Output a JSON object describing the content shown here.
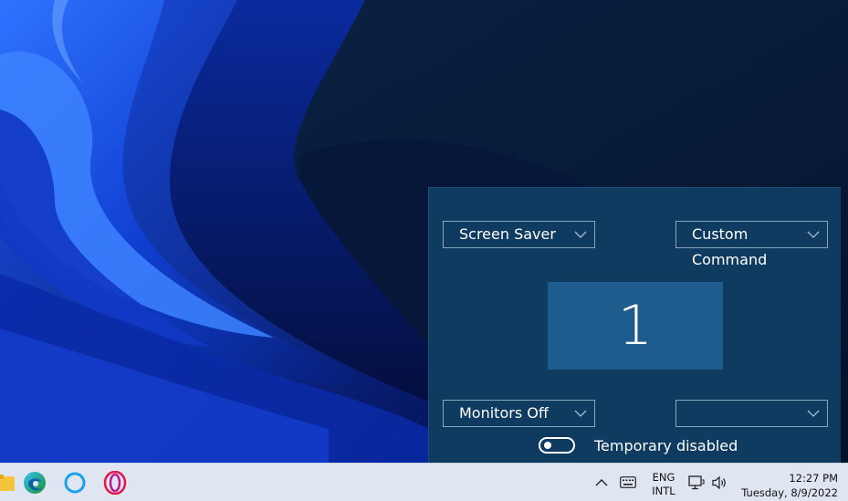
{
  "panel": {
    "top_left_action": "Screen Saver",
    "top_right_action": "Custom Command",
    "bottom_left_action": "Monitors Off",
    "bottom_right_action": "",
    "monitor_number": "1",
    "toggle_label": "Temporary disabled",
    "toggle_on": false
  },
  "taskbar": {
    "pinned_icons": [
      "file-explorer-icon",
      "edge-icon",
      "cortana-icon",
      "opera-icon"
    ],
    "tray": {
      "language_line1": "ENG",
      "language_line2": "INTL",
      "time": "12:27 PM",
      "date": "Tuesday, 8/9/2022"
    }
  },
  "colors": {
    "panel_bg": "#0f3b60",
    "monitor_bg": "#1d5c8d",
    "taskbar_bg": "#dfe6f1"
  }
}
